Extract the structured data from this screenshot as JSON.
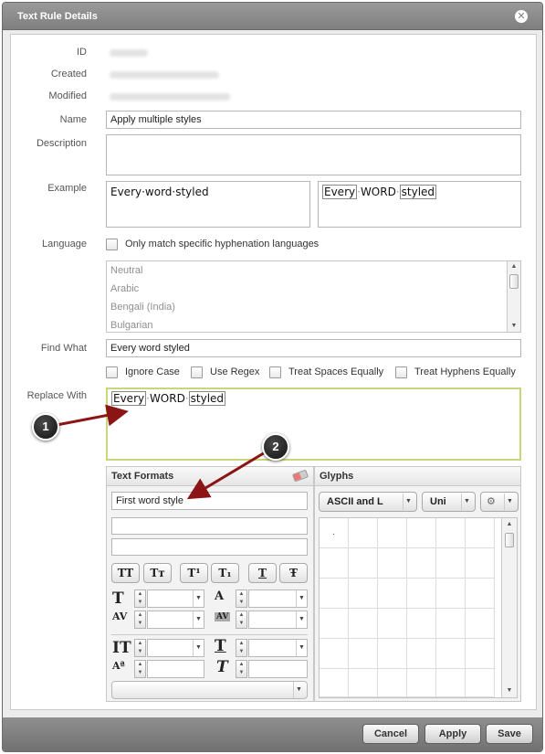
{
  "dialog": {
    "title": "Text Rule Details"
  },
  "fields": {
    "id_label": "ID",
    "created_label": "Created",
    "modified_label": "Modified",
    "name_label": "Name",
    "name_value": "Apply multiple styles",
    "description_label": "Description",
    "description_value": "",
    "example_label": "Example",
    "example_before": "Every·word·styled",
    "example_after_words": [
      "Every",
      "WORD",
      "styled"
    ],
    "language_label": "Language",
    "language_checkbox": "Only match specific hyphenation languages",
    "languages": [
      "Neutral",
      "Arabic",
      "Bengali (India)",
      "Bulgarian"
    ],
    "find_label": "Find What",
    "find_value": "Every word styled",
    "options": [
      "Ignore Case",
      "Use Regex",
      "Treat Spaces Equally",
      "Treat Hyphens Equally"
    ],
    "replace_label": "Replace With",
    "replace_words": [
      "Every",
      "WORD",
      "styled"
    ]
  },
  "text_formats": {
    "header": "Text Formats",
    "first_value": "First word style",
    "style_buttons": [
      "TT",
      "Tт",
      "T¹",
      "T₁",
      "T",
      "Ŧ"
    ]
  },
  "glyphs": {
    "header": "Glyphs",
    "set_select": "ASCII and L",
    "encoding_select": "Uni",
    "first_glyph": "."
  },
  "footer": {
    "cancel": "Cancel",
    "apply": "Apply",
    "save": "Save"
  },
  "callouts": {
    "one": "1",
    "two": "2"
  },
  "colors": {
    "accent_border": "#c7d87a",
    "arrow": "#8b1414"
  }
}
